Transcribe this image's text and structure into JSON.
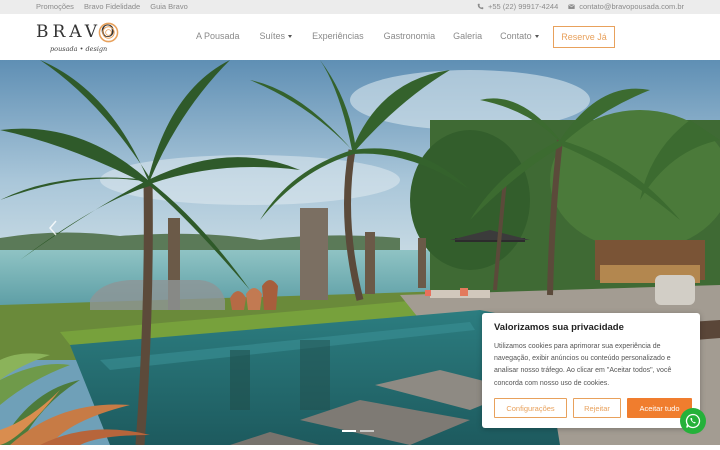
{
  "topbar": {
    "links": [
      "Promoções",
      "Bravo Fidelidade",
      "Guia Bravo"
    ],
    "phone": "+55 (22) 99917-4244",
    "email": "contato@bravopousada.com.br"
  },
  "brand": {
    "name": "BRAVO",
    "tagline": "pousada • design",
    "accent_color": "#e8a15c"
  },
  "nav": {
    "items": [
      {
        "label": "A Pousada",
        "dropdown": false
      },
      {
        "label": "Suítes",
        "dropdown": true
      },
      {
        "label": "Experiências",
        "dropdown": false
      },
      {
        "label": "Gastronomia",
        "dropdown": false
      },
      {
        "label": "Galeria",
        "dropdown": false
      },
      {
        "label": "Contato",
        "dropdown": true
      }
    ],
    "reserve_label": "Reserve Já"
  },
  "hero": {
    "slide_count": 2,
    "active_slide": 1
  },
  "cookie": {
    "title": "Valorizamos sua privacidade",
    "body": "Utilizamos cookies para aprimorar sua experiência de navegação, exibir anúncios ou conteúdo personalizado e analisar nosso tráfego. Ao clicar em \"Aceitar todos\", você concorda com nosso uso de cookies.",
    "configure_label": "Configurações",
    "reject_label": "Rejeitar",
    "accept_label": "Aceitar tudo",
    "accept_color": "#f07d2e"
  },
  "whatsapp": {
    "icon": "whatsapp-icon",
    "color": "#25b13a"
  }
}
